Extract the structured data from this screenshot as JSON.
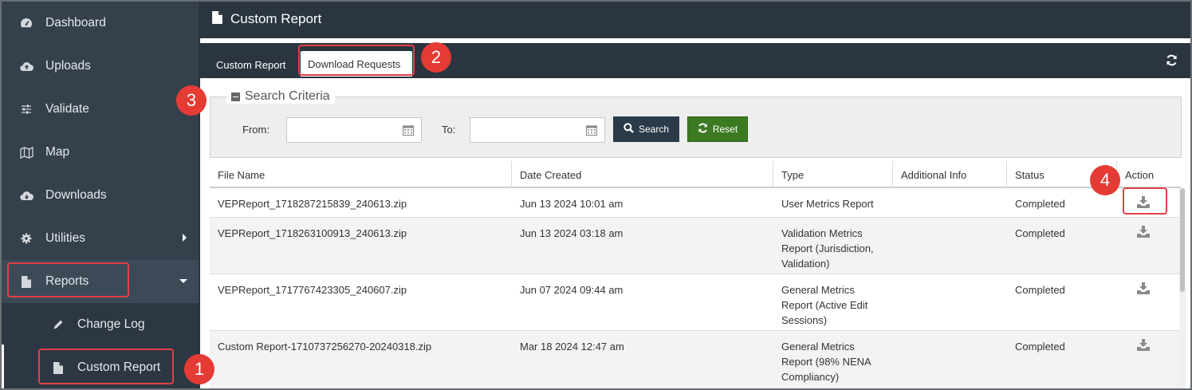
{
  "sidebar": {
    "items": [
      {
        "label": "Dashboard",
        "icon": "dashboard-icon"
      },
      {
        "label": "Uploads",
        "icon": "cloud-upload-icon"
      },
      {
        "label": "Validate",
        "icon": "sliders-icon"
      },
      {
        "label": "Map",
        "icon": "map-icon"
      },
      {
        "label": "Downloads",
        "icon": "cloud-download-icon"
      },
      {
        "label": "Utilities",
        "icon": "gear-icon"
      },
      {
        "label": "Reports",
        "icon": "file-icon"
      }
    ],
    "subitems": [
      {
        "label": "Change Log",
        "icon": "pencil-icon"
      },
      {
        "label": "Custom Report",
        "icon": "file-icon"
      }
    ]
  },
  "header": {
    "title": "Custom Report"
  },
  "tabs": {
    "custom_report": "Custom Report",
    "download_requests": "Download Requests"
  },
  "search": {
    "legend": "Search Criteria",
    "from_label": "From:",
    "to_label": "To:",
    "from_value": "",
    "to_value": "",
    "search_button": "Search",
    "reset_button": "Reset"
  },
  "table": {
    "columns": [
      "File Name",
      "Date Created",
      "Type",
      "Additional Info",
      "Status",
      "Action"
    ],
    "rows": [
      {
        "file": "VEPReport_1718287215839_240613.zip",
        "date": "Jun 13 2024 10:01 am",
        "type": [
          "User Metrics Report"
        ],
        "info": "",
        "status": "Completed"
      },
      {
        "file": "VEPReport_1718263100913_240613.zip",
        "date": "Jun 13 2024 03:18 am",
        "type": [
          "Validation Metrics",
          "Report (Jurisdiction,",
          "Validation)"
        ],
        "info": "",
        "status": "Completed"
      },
      {
        "file": "VEPReport_1717767423305_240607.zip",
        "date": "Jun 07 2024 09:44 am",
        "type": [
          "General Metrics",
          "Report (Active Edit",
          "Sessions)"
        ],
        "info": "",
        "status": "Completed"
      },
      {
        "file": "Custom Report-1710737256270-20240318.zip",
        "date": "Mar 18 2024 12:47 am",
        "type": [
          "General Metrics",
          "Report (98% NENA",
          "Compliancy)"
        ],
        "info": "",
        "status": "Completed"
      }
    ]
  },
  "callouts": [
    "1",
    "2",
    "3",
    "4"
  ],
  "colors": {
    "sidebar": "#34404c",
    "header": "#2b3540",
    "callout": "#e53b35",
    "reset": "#3c7a22",
    "search": "#2b3a48"
  }
}
